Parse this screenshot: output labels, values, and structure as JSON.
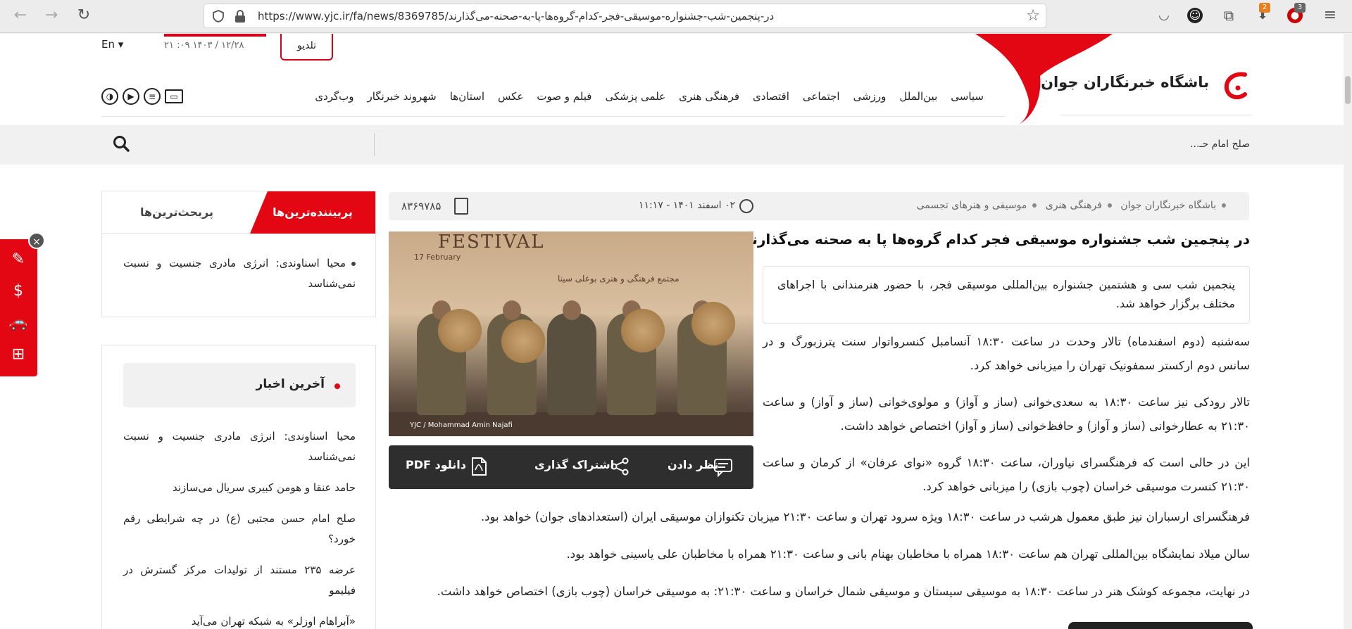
{
  "browser": {
    "url": "https://www.yjc.ir/fa/news/8369785/در-پنجمین-شب-جشنواره-موسیقی-فجر-کدام-گروه‌ها-پا-به-صحنه-می‌گذارند",
    "badge_ext1": "2",
    "badge_ext2": "3"
  },
  "header": {
    "site_name": "باشگاه خبرنگاران جوان",
    "lang": "En ▾",
    "datetime": "۲۱ :۰۹   ۱۴۰۳ / ۱۲/۲۸",
    "tv_tab": "تلدیو",
    "nav": [
      "سیاسی",
      "بین‌الملل",
      "ورزشی",
      "اجتماعی",
      "اقتصادی",
      "فرهنگی هنری",
      "علمی پزشکی",
      "فیلم و صوت",
      "عکس",
      "استان‌ها",
      "شهروند خبرنگار",
      "وب‌گردی"
    ],
    "icons": [
      "tv-icon",
      "menu-list-icon",
      "play-icon",
      "gallery-icon"
    ]
  },
  "ticker": {
    "text": "صلح امام حـ..."
  },
  "sidebar": {
    "tab_active": "پربیننده‌ترین‌ها",
    "tab_inactive": "پربحث‌ترین‌ها",
    "top_item": "محیا اسناوندی: انرژی مادری جنسیت و نسبت نمی‌شناسد",
    "latest_title": "آخرین اخبار",
    "latest": [
      "محیا اسناوندی: انرژی مادری جنسیت و نسبت نمی‌شناسد",
      "حامد عنقا و هومن کبیری سریال می‌سازند",
      "صلح امام حسن مجتبی (ع) در چه شرایطی رقم خورد؟",
      "عرضه ۲۳۵ مستند از تولیدات مرکز گسترش در فیلیمو",
      "«آبراهام اوزلر» به شبکه تهران می‌آید"
    ]
  },
  "article": {
    "breadcrumb": [
      "باشگاه خبرنگاران جوان",
      "فرهنگی هنری",
      "موسیقی و هنرهای تجسمی"
    ],
    "pubdate": "۰۲ اسفند ۱۴۰۱ - ۱۱:۱۷",
    "news_id": "۸۳۶۹۷۸۵",
    "title": "در پنجمین شب جشنواره موسیقی فجر کدام گروه‌ها پا به صحنه می‌گذارند؟",
    "lead": "پنجمین شب سی و هشتمین جشنواره بین‌المللی موسیقی فجر، با حضور هنرمندانی با اجراهای مختلف برگزار خواهد شد.",
    "paragraphs": [
      "سه‌شنبه (دوم اسفندماه) تالار وحدت در ساعت ۱۸:۳۰ آنسامبل کنسرواتوار سنت پترزبورگ و در سانس دوم ارکستر سمفونیک تهران را میزبانی خواهد کرد.",
      "تالار رودکی نیز ساعت ۱۸:۳۰ به سعدی‌خوانی (ساز و آواز) و مولوی‌خوانی (ساز و آواز) و ساعت ۲۱:۳۰ به عطارخوانی (ساز و آواز) و حافظ‌خوانی (ساز و آواز) اختصاص خواهد داشت.",
      "این در حالی است که فرهنگسرای نیاوران، ساعت ۱۸:۳۰ گروه «نوای عرفان» از کرمان و ساعت ۲۱:۳۰ کنسرت موسیقی خراسان (چوب بازی) را میزبانی خواهد کرد.",
      "فرهنگسرای ارسباران نیز طبق معمول هرشب در ساعت ۱۸:۳۰ ویژه سرود تهران و ساعت ۲۱:۳۰ میزبان تکنوازان موسیقی ایران (استعدادهای جوان) خواهد بود.",
      "سالن میلاد نمایشگاه بین‌المللی تهران هم ساعت ۱۸:۳۰ همراه با مخاطبان بهنام بانی و ساعت ۲۱:۳۰ همراه با مخاطبان علی یاسینی خواهد بود.",
      "در نهایت، مجموعه کوشک هنر در ساعت ۱۸:۳۰ به موسیقی سیستان و موسیقی شمال خراسان و ساعت ۲۱:۳۰: به موسیقی خراسان (چوب بازی) اختصاص خواهد داشت."
    ],
    "photo": {
      "festival_word": "FESTIVAL",
      "date_label": "17 February",
      "sub_label": "مجتمع فرهنگی و هنری بوعلی سینا",
      "credit": "YJC / Mohammad Amin Najafi"
    },
    "actions": {
      "comment": "نظر دادن",
      "share": "اشتراک گذاری",
      "pdf": "دانلود PDF"
    }
  },
  "colors": {
    "brand_red": "#e30613",
    "action_bar": "#2e2e2e"
  }
}
